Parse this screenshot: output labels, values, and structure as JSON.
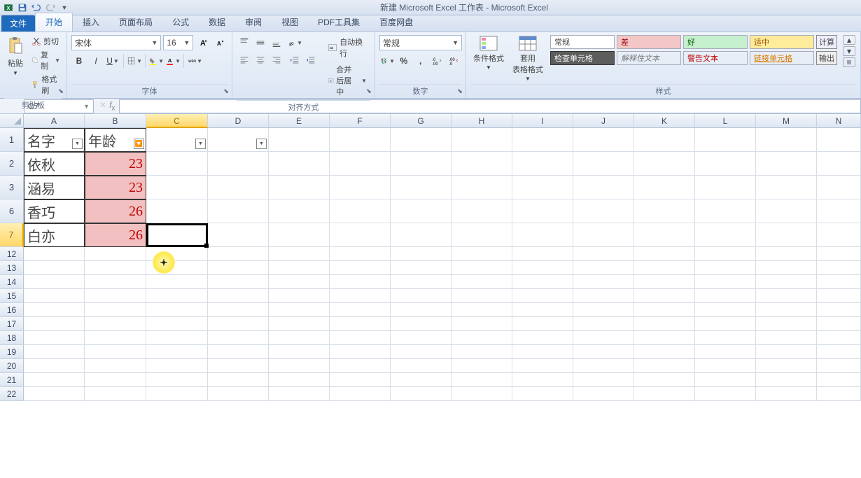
{
  "titlebar": {
    "title": "新建 Microsoft Excel 工作表 - Microsoft Excel"
  },
  "tabs": {
    "file": "文件",
    "home": "开始",
    "insert": "插入",
    "layout": "页面布局",
    "formulas": "公式",
    "data": "数据",
    "review": "审阅",
    "view": "视图",
    "pdf": "PDF工具集",
    "baidu": "百度网盘"
  },
  "clipboard": {
    "paste": "粘贴",
    "cut": "剪切",
    "copy": "复制",
    "format_painter": "格式刷",
    "group": "剪贴板"
  },
  "font": {
    "name": "宋体",
    "size": "16",
    "group": "字体"
  },
  "alignment": {
    "wrap": "自动换行",
    "merge": "合并后居中",
    "group": "对齐方式"
  },
  "number": {
    "format": "常规",
    "group": "数字"
  },
  "styles": {
    "cond": "条件格式",
    "table": "套用\n表格格式",
    "group": "样式",
    "normal": "常规",
    "bad": "差",
    "good": "好",
    "neutral": "适中",
    "check": "检查单元格",
    "explain": "解释性文本",
    "warn": "警告文本",
    "link": "链接单元格",
    "calc": "计算",
    "output": "输出"
  },
  "namebox": "C7",
  "columns": [
    "A",
    "B",
    "C",
    "D",
    "E",
    "F",
    "G",
    "H",
    "I",
    "J",
    "K",
    "L",
    "M",
    "N"
  ],
  "data_rows": [
    {
      "num": "1",
      "a": "名字",
      "b": "年龄",
      "is_header": true
    },
    {
      "num": "2",
      "a": "依秋",
      "b": "23"
    },
    {
      "num": "3",
      "a": "涵易",
      "b": "23"
    },
    {
      "num": "6",
      "a": "香巧",
      "b": "26"
    },
    {
      "num": "7",
      "a": "白亦",
      "b": "26"
    }
  ],
  "blank_rows": [
    "12",
    "13",
    "14",
    "15",
    "16",
    "17",
    "18",
    "19",
    "20",
    "21",
    "22"
  ]
}
